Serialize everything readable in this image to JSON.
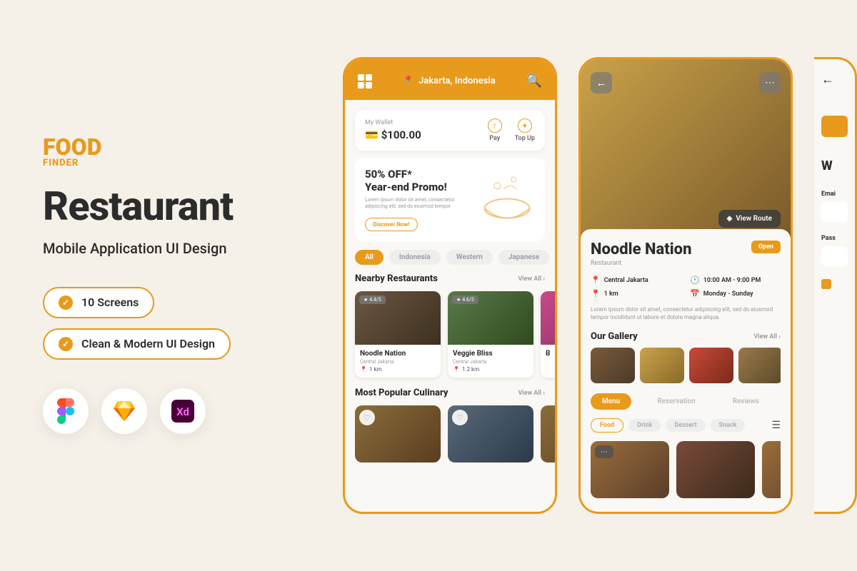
{
  "logo": {
    "main": "FOOD",
    "sub": "FINDER"
  },
  "title": "Restaurant",
  "subtitle": "Mobile Application UI Design",
  "chips": [
    "10 Screens",
    "Clean & Modern UI Design"
  ],
  "colors": {
    "accent": "#E89A1C"
  },
  "screen1": {
    "location": "Jakarta, Indonesia",
    "wallet": {
      "label": "My Wallet",
      "amount": "$100.00",
      "pay": "Pay",
      "topup": "Top Up"
    },
    "promo": {
      "title1": "50% OFF*",
      "title2": "Year-end Promo!",
      "desc": "Lorem ipsum dolor sit amet, consectetur adipiscing elit, sed do eiusmod tempor",
      "btn": "Discover Now!"
    },
    "filters": [
      "All",
      "Indonesia",
      "Western",
      "Japanese"
    ],
    "section1": {
      "title": "Nearby Restaurants",
      "viewAll": "View All"
    },
    "restaurants": [
      {
        "name": "Noodle Nation",
        "loc": "Central Jakarta",
        "dist": "1 km",
        "rating": "4.4/5"
      },
      {
        "name": "Veggie Bliss",
        "loc": "Central Jakarta",
        "dist": "1.2 km",
        "rating": "4.6/5"
      },
      {
        "name": "B",
        "loc": "",
        "dist": "",
        "rating": ""
      }
    ],
    "section2": {
      "title": "Most Popular Culinary",
      "viewAll": "View All"
    }
  },
  "screen2": {
    "viewRoute": "View Route",
    "name": "Noodle Nation",
    "type": "Restaurant",
    "status": "Open",
    "location": "Central Jakarta",
    "hours": "10:00 AM - 9:00 PM",
    "distance": "1 km",
    "days": "Monday - Sunday",
    "desc": "Lorem ipsum dolor sit amet, consectetur adipiscing elit, sed do eiusmod tempor incididunt ut labore et dolore magna aliqua.",
    "gallery": {
      "title": "Our Gallery",
      "viewAll": "View All"
    },
    "tabs": [
      "Menu",
      "Reservation",
      "Reviews"
    ],
    "subfilters": [
      "Food",
      "Drink",
      "Dessert",
      "Snack"
    ]
  },
  "screen3": {
    "title": "W",
    "emailLabel": "Emai",
    "passLabel": "Pass"
  }
}
